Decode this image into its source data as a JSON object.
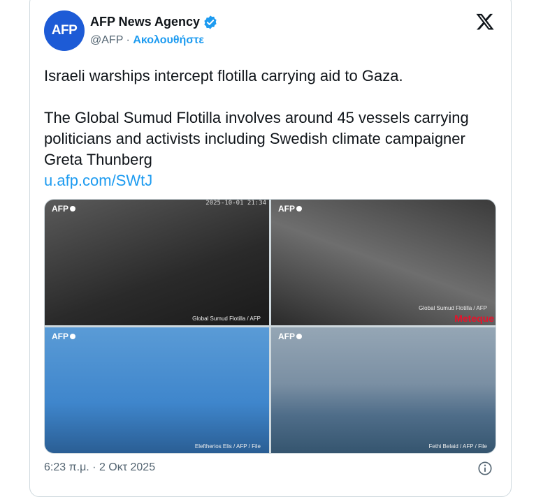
{
  "account": {
    "avatar_text": "AFP",
    "name": "AFP News Agency",
    "handle": "@AFP",
    "separator": "·",
    "follow_label": "Ακολουθήστε",
    "brand_color": "#1d5bd6"
  },
  "tweet": {
    "line1": "Israeli warships intercept flotilla carrying aid to Gaza.",
    "line2": "The Global Sumud Flotilla involves around 45 vessels carrying politicians and activists including Swedish climate campaigner Greta Thunberg",
    "link": "u.afp.com/SWtJ"
  },
  "media": [
    {
      "watermark": "AFP",
      "timestamp": "2025-10-01 21:34",
      "credit": "Global Sumud Flotilla / AFP"
    },
    {
      "watermark": "AFP",
      "credit": "Global Sumud Flotilla / AFP",
      "overlay": "Meteque"
    },
    {
      "watermark": "AFP",
      "credit": "Eleftherios Elis / AFP / File"
    },
    {
      "watermark": "AFP",
      "credit": "Fethi Belaid / AFP / File"
    }
  ],
  "footer": {
    "timestamp": "6:23 π.μ. · 2 Οκτ 2025"
  },
  "icons": {
    "verified": "verified-badge-icon",
    "x_logo": "x-logo-icon",
    "info": "info-icon"
  }
}
